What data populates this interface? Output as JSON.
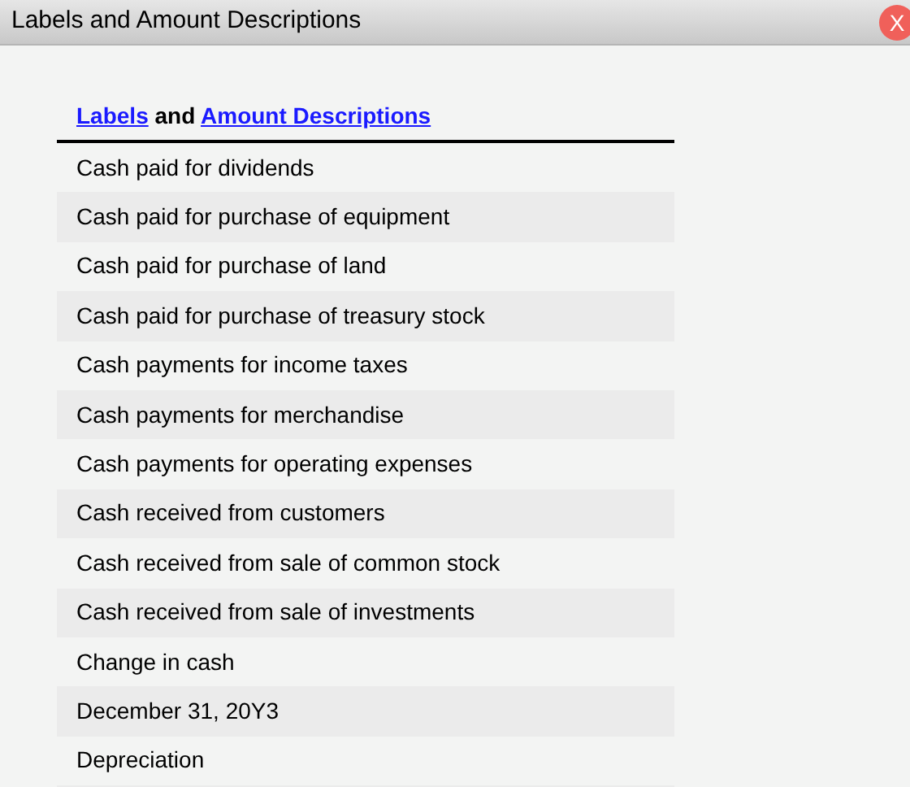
{
  "window": {
    "title": "Labels and Amount Descriptions",
    "close": "X"
  },
  "header": {
    "link_1": "Labels",
    "joiner": "and",
    "link_2": "Amount Descriptions"
  },
  "rows": [
    "Cash paid for dividends",
    "Cash paid for purchase of equipment",
    "Cash paid for purchase of land",
    "Cash paid for purchase of treasury stock",
    "Cash payments for income taxes",
    "Cash payments for merchandise",
    "Cash payments for operating expenses",
    "Cash received from customers",
    "Cash received from sale of common stock",
    "Cash received from sale of investments",
    "Change in cash",
    "December 31, 20Y3",
    "Depreciation"
  ]
}
